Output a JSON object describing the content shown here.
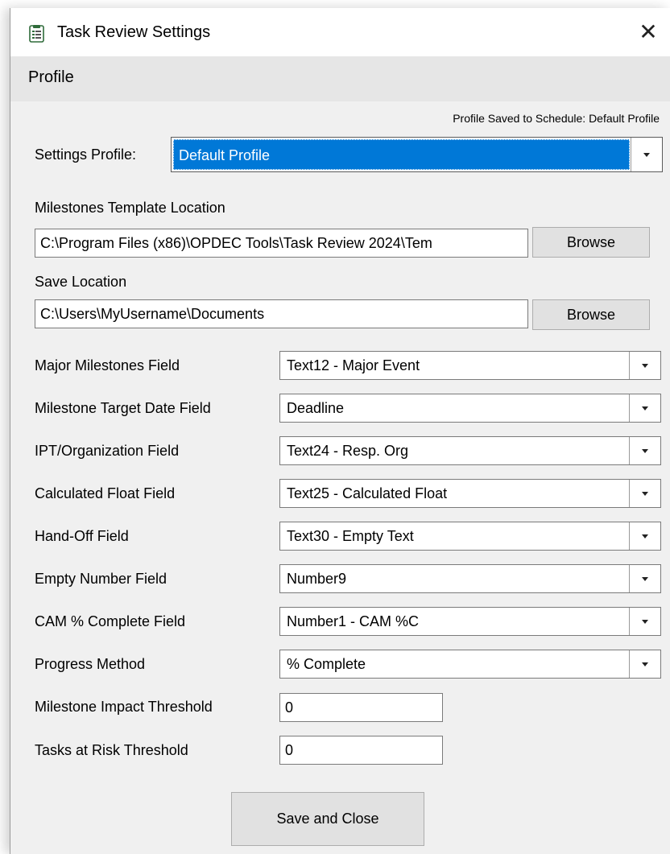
{
  "window": {
    "title": "Task Review Settings",
    "close_glyph": "✕"
  },
  "menu": {
    "items": [
      "Profile"
    ]
  },
  "profile": {
    "saved_note": "Profile Saved to Schedule: Default Profile",
    "label": "Settings Profile:",
    "value": "Default Profile"
  },
  "template": {
    "label": "Milestones Template Location",
    "path": "C:\\Program Files (x86)\\OPDEC Tools\\Task Review 2024\\Tem",
    "browse_label": "Browse"
  },
  "save_location": {
    "label": "Save Location",
    "path": "C:\\Users\\MyUsername\\Documents",
    "browse_label": "Browse"
  },
  "fields": [
    {
      "label": "Major Milestones Field",
      "value": "Text12 - Major Event"
    },
    {
      "label": "Milestone Target Date Field",
      "value": "Deadline"
    },
    {
      "label": "IPT/Organization Field",
      "value": "Text24 - Resp. Org"
    },
    {
      "label": "Calculated Float Field",
      "value": "Text25 - Calculated Float"
    },
    {
      "label": "Hand-Off Field",
      "value": "Text30 - Empty Text"
    },
    {
      "label": "Empty Number Field",
      "value": "Number9"
    },
    {
      "label": "CAM % Complete Field",
      "value": "Number1 - CAM %C"
    },
    {
      "label": "Progress Method",
      "value": "% Complete"
    }
  ],
  "thresholds": [
    {
      "label": "Milestone Impact Threshold",
      "value": "0"
    },
    {
      "label": "Tasks at Risk Threshold",
      "value": "0"
    }
  ],
  "save_close_label": "Save and Close",
  "icons": {
    "app": "task-list-icon",
    "dropdown": "chevron-down-icon",
    "close": "close-icon"
  },
  "colors": {
    "selection": "#0078d7",
    "window_bg": "#f0f0f0",
    "menubar_bg": "#e6e6e6"
  }
}
